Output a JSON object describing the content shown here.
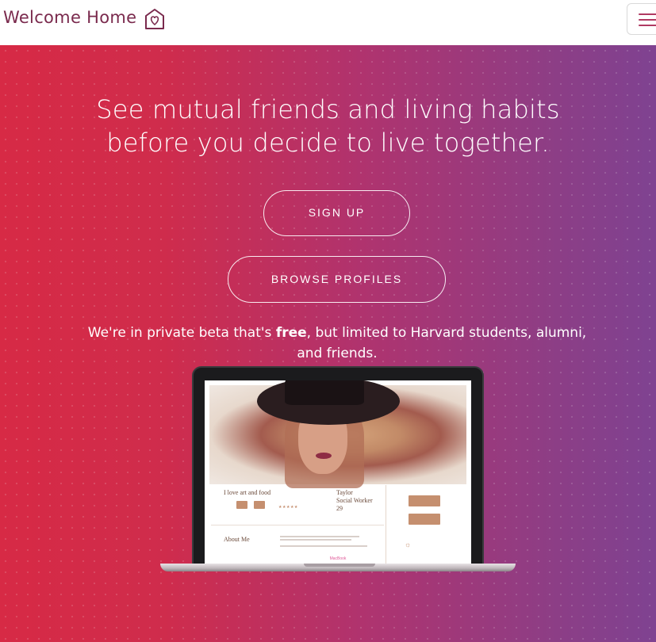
{
  "navbar": {
    "brand": "Welcome Home",
    "brand_icon": "house-heart-icon",
    "menu_icon": "hamburger-menu-icon"
  },
  "hero": {
    "headline_line1": "See mutual friends and living habits",
    "headline_line2": "before you decide to live together.",
    "signup_label": "SIGN UP",
    "browse_label": "BROWSE PROFILES",
    "beta_prefix": "We're in private beta that's ",
    "beta_bold": "free",
    "beta_suffix": ", but limited to Harvard students, alumni, and friends."
  },
  "laptop": {
    "brand_label": "MacBook",
    "screen": {
      "loves": "I love art and food",
      "name": "Taylor",
      "job": "Social Worker",
      "age": "29",
      "about_heading": "About Me"
    }
  },
  "colors": {
    "gradient_left": "#d72a45",
    "gradient_right": "#7f4291",
    "brand_text": "#7a2a4d",
    "accent_tan": "#c58f6f"
  }
}
